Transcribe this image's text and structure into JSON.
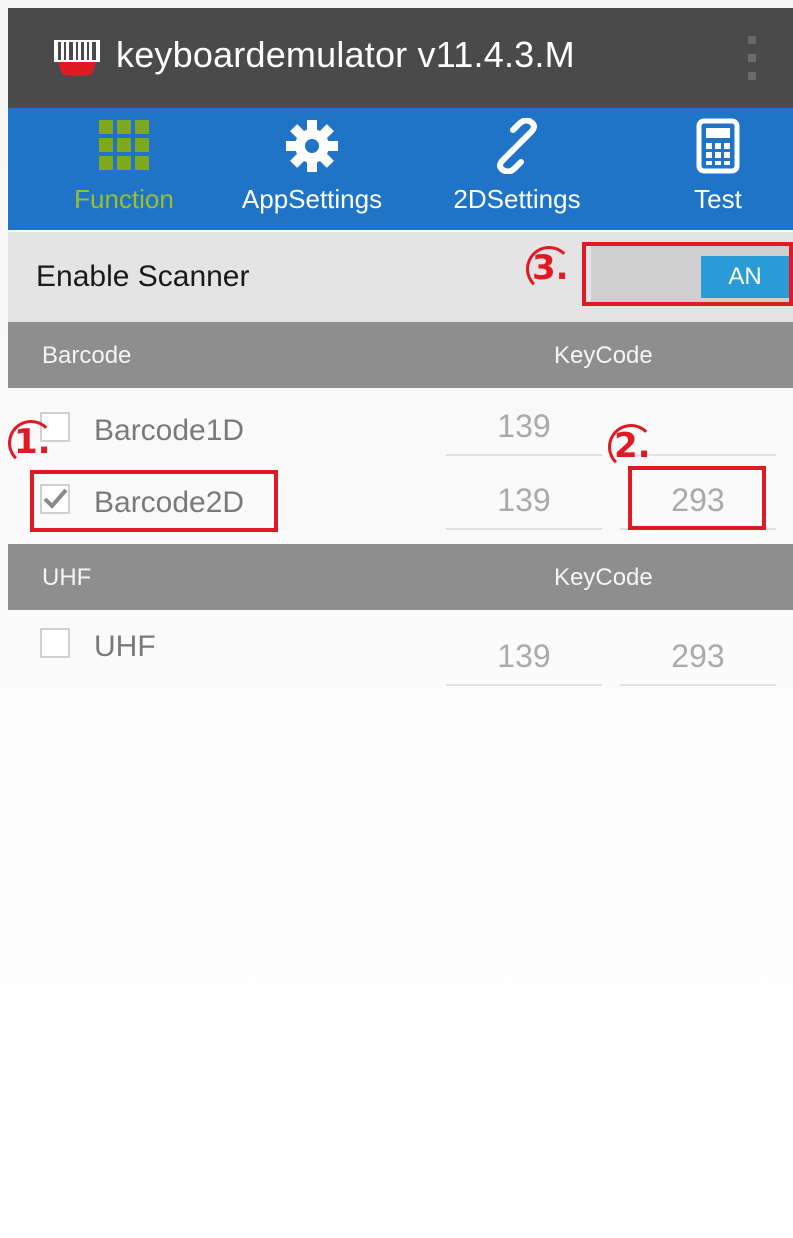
{
  "titlebar": {
    "title": "keyboardemulator v11.4.3.M",
    "icon": "barcode-scanner-icon",
    "overflow_icon": "overflow-menu-icon"
  },
  "tabs": [
    {
      "label": "Function",
      "icon": "grid-icon",
      "active": true
    },
    {
      "label": "AppSettings",
      "icon": "gear-icon",
      "active": false
    },
    {
      "label": "2DSettings",
      "icon": "link-icon",
      "active": false
    },
    {
      "label": "Test",
      "icon": "calculator-icon",
      "active": false
    }
  ],
  "enable_scanner": {
    "label": "Enable Scanner",
    "toggle_text": "AN"
  },
  "barcode_section": {
    "header_left": "Barcode",
    "header_right": "KeyCode",
    "items": [
      {
        "label": "Barcode1D",
        "checked": false,
        "keycode1": "139",
        "keycode2": ""
      },
      {
        "label": "Barcode2D",
        "checked": true,
        "keycode1": "139",
        "keycode2": "293"
      }
    ]
  },
  "uhf_section": {
    "header_left": "UHF",
    "header_right": "KeyCode",
    "items": [
      {
        "label": "UHF",
        "checked": false,
        "keycode1": "139",
        "keycode2": "293"
      }
    ]
  },
  "annotations": {
    "marker1": "1.",
    "marker2": "2.",
    "marker3": "3."
  },
  "colors": {
    "titlebar": "#4a4a4a",
    "tabbar": "#1f74c7",
    "active_tab": "#9abf2a",
    "toggle_on": "#2a9bd6",
    "annotation_red": "#e01a24"
  }
}
